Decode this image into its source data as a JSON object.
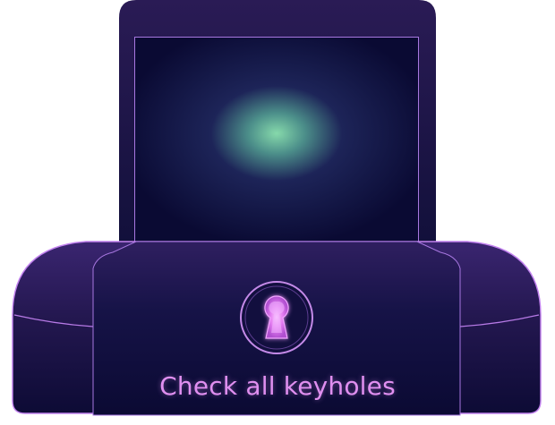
{
  "hint": {
    "text": "Check all keyholes"
  },
  "colors": {
    "background": "#ffffff",
    "frame_dark": "#0b0a33",
    "frame_purple": "#2a1a55",
    "neon_outline": "#b77ae6",
    "glow_center": "#7fd6a8",
    "keyhole_glow": "#f2a6ff",
    "hint_text": "#e08ff0"
  },
  "icons": {
    "keyhole": "keyhole-icon"
  }
}
